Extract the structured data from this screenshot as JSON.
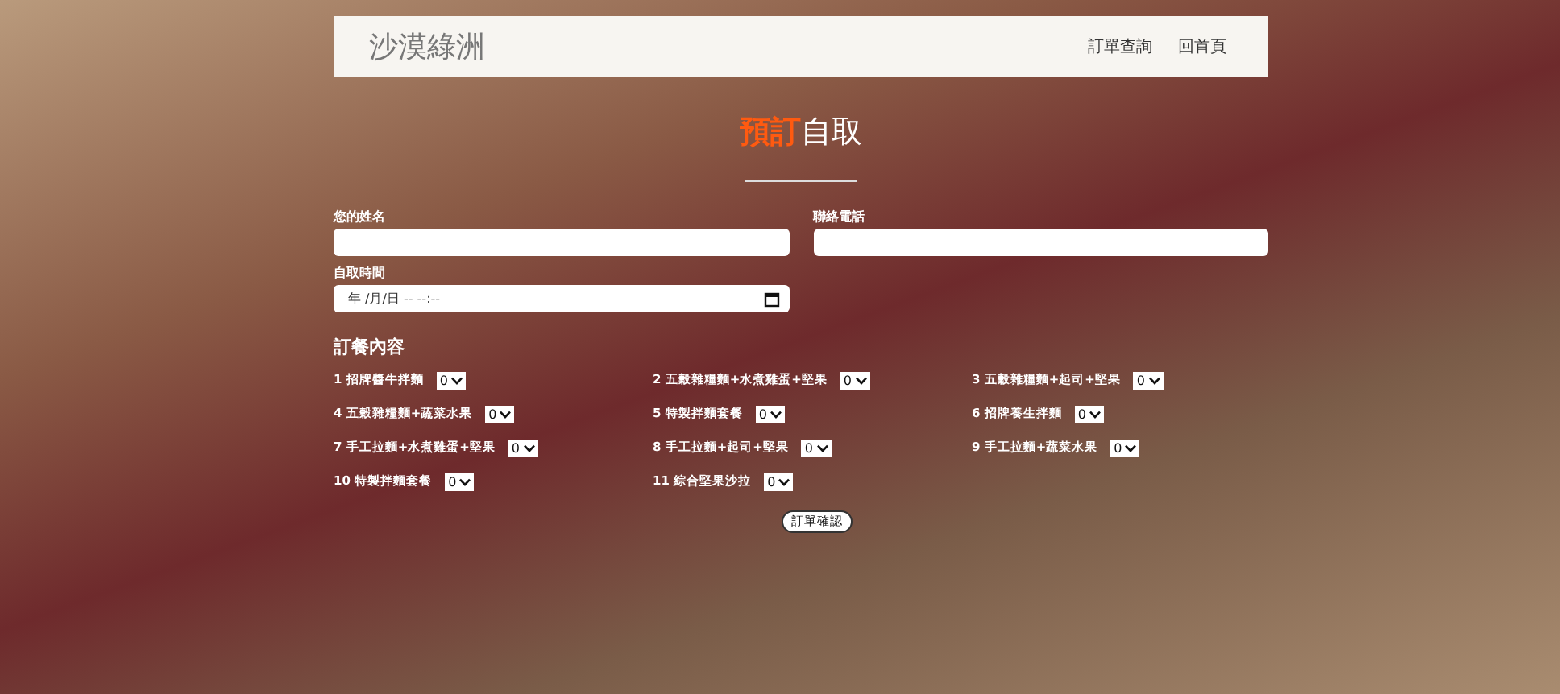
{
  "navbar": {
    "brand": "沙漠綠洲",
    "links": [
      "訂單查詢",
      "回首頁"
    ]
  },
  "heading": {
    "highlight": "預訂",
    "rest": "自取"
  },
  "form": {
    "name_label": "您的姓名",
    "phone_label": "聯絡電話",
    "time_label": "自取時間",
    "time_placeholder": "年 /月/日 -- --:--"
  },
  "order": {
    "title": "訂餐內容",
    "items": [
      {
        "label": "1 招牌醬牛拌麵",
        "quantity": "0"
      },
      {
        "label": "2 五穀雜糧麵+水煮雞蛋+堅果",
        "quantity": "0"
      },
      {
        "label": "3 五穀雜糧麵+起司+堅果",
        "quantity": "0"
      },
      {
        "label": "4 五穀雜糧麵+蔬菜水果",
        "quantity": "0"
      },
      {
        "label": "5 特製拌麵套餐",
        "quantity": "0"
      },
      {
        "label": "6 招牌養生拌麵",
        "quantity": "0"
      },
      {
        "label": "7 手工拉麵+水煮雞蛋+堅果",
        "quantity": "0"
      },
      {
        "label": "8 手工拉麵+起司+堅果",
        "quantity": "0"
      },
      {
        "label": "9 手工拉麵+蔬菜水果",
        "quantity": "0"
      },
      {
        "label": "10 特製拌麵套餐",
        "quantity": "0"
      },
      {
        "label": "11 綜合堅果沙拉",
        "quantity": "0"
      }
    ],
    "submit": "訂單確認"
  }
}
